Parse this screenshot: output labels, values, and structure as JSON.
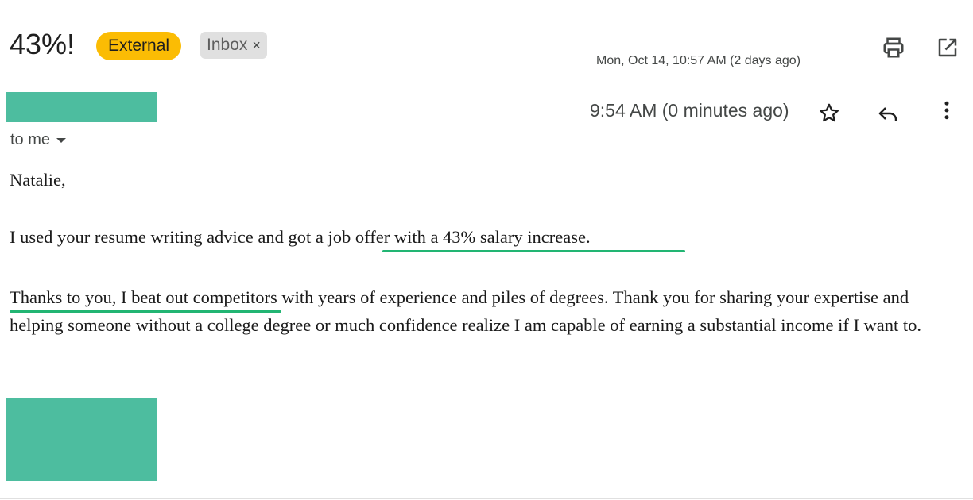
{
  "header": {
    "subject": "43%!",
    "labels": {
      "external": "External",
      "inbox": "Inbox",
      "inbox_remove": "×"
    },
    "thread_date": "Mon, Oct 14, 10:57 AM (2 days ago)",
    "icons": [
      "print-icon",
      "open-in-new-window-icon"
    ]
  },
  "message": {
    "recipient_label": "to me",
    "time": "9:54 AM (0 minutes ago)",
    "icons": [
      "star-icon",
      "reply-icon",
      "more-vert-icon",
      "chevron-down-icon"
    ],
    "body": {
      "greeting": "Natalie,",
      "line1": "I used your resume writing advice and got a job offer with a 43% salary increase.",
      "paragraph2": "Thanks to you, I beat out competitors with years of experience and piles of degrees. Thank you for sharing your expertise and helping someone without a college degree or much confidence realize I am capable of earning a substantial income if I want to."
    }
  },
  "colors": {
    "external_badge": "#fbbc04",
    "inbox_badge": "#e0e0e0",
    "redaction_block": "#4dbd9f",
    "highlight_underline": "#22b573"
  }
}
